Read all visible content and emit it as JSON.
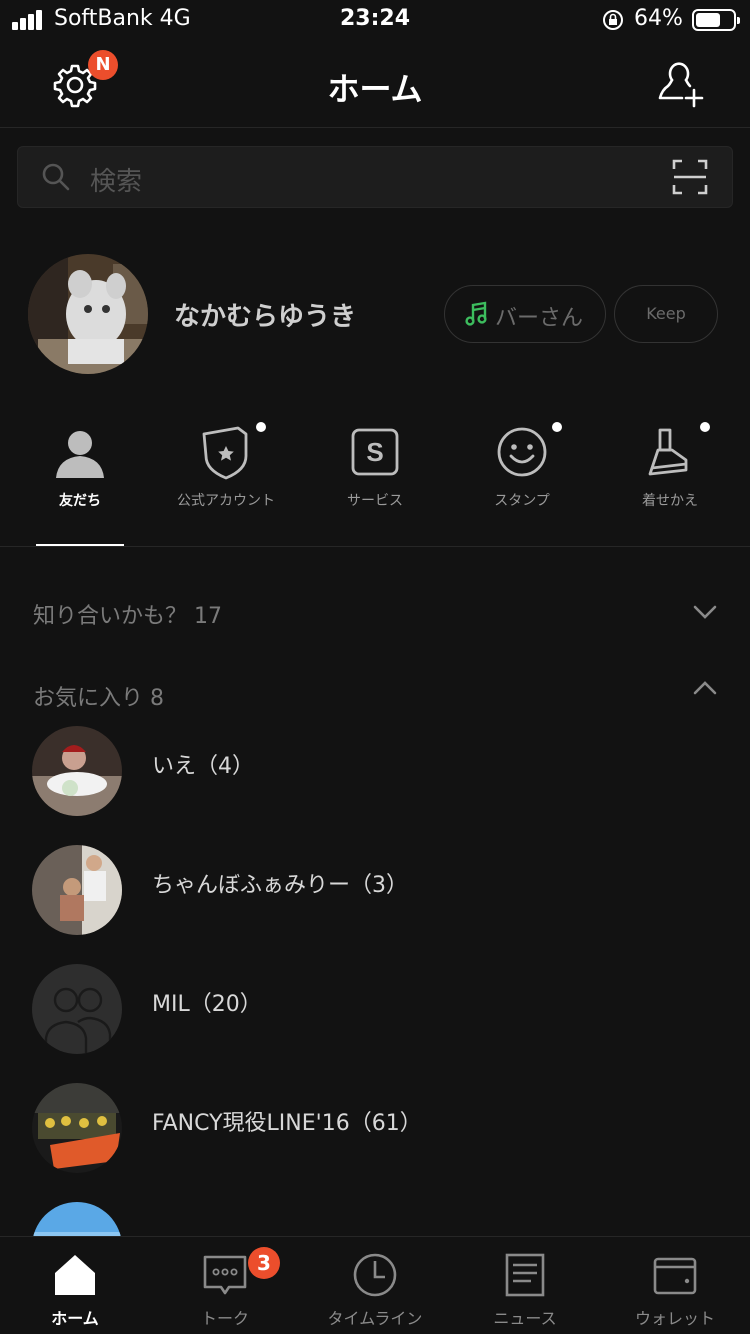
{
  "status_bar": {
    "carrier": "SoftBank 4G",
    "time": "23:24",
    "battery_percent": "64%"
  },
  "header": {
    "title": "ホーム",
    "settings_badge": "N"
  },
  "search": {
    "placeholder": "検索"
  },
  "profile": {
    "name": "なかむらゆうき",
    "bgm_label": "バーさん",
    "keep_label": "Keep"
  },
  "categories": [
    {
      "label": "友だち",
      "icon": "person-icon",
      "active": true,
      "dot": false
    },
    {
      "label": "公式アカウント",
      "icon": "official-shield-icon",
      "active": false,
      "dot": true
    },
    {
      "label": "サービス",
      "icon": "service-s-icon",
      "active": false,
      "dot": false
    },
    {
      "label": "スタンプ",
      "icon": "smile-icon",
      "active": false,
      "dot": true
    },
    {
      "label": "着せかえ",
      "icon": "brush-icon",
      "active": false,
      "dot": true
    }
  ],
  "sections": {
    "suggested": {
      "label": "知り合いかも？ 17",
      "state": "collapsed"
    },
    "favorites": {
      "label": "お気に入り 8",
      "state": "expanded"
    }
  },
  "favorites": [
    {
      "name": "いえ（4）"
    },
    {
      "name": "ちゃんぼふぁみりー（3）"
    },
    {
      "name": "MIL（20）"
    },
    {
      "name": "FANCY現役LINE'16（61）"
    }
  ],
  "tabs": [
    {
      "label": "ホーム",
      "icon": "home-icon",
      "active": true
    },
    {
      "label": "トーク",
      "icon": "talk-bubble-icon",
      "active": false,
      "badge": "3"
    },
    {
      "label": "タイムライン",
      "icon": "clock-icon",
      "active": false
    },
    {
      "label": "ニュース",
      "icon": "news-icon",
      "active": false
    },
    {
      "label": "ウォレット",
      "icon": "wallet-icon",
      "active": false
    }
  ],
  "colors": {
    "background": "#121212",
    "badge": "#ec4e2c",
    "music_note": "#3dbd5e"
  }
}
